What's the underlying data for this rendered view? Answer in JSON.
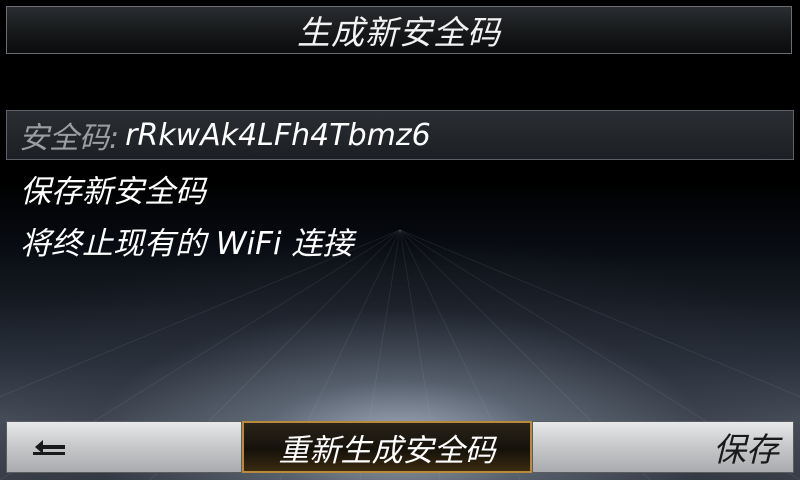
{
  "title": "生成新安全码",
  "security_code": {
    "label": "安全码:",
    "value": "rRkwAk4LFh4Tbmz6"
  },
  "messages": [
    "保存新安全码",
    "将终止现有的 WiFi 连接"
  ],
  "bottom_bar": {
    "back_icon": "back-arrow-icon",
    "regenerate_label": "重新生成安全码",
    "save_label": "保存"
  },
  "colors": {
    "selected_border": "#b98a3a",
    "code_label": "#9c9ea2"
  }
}
